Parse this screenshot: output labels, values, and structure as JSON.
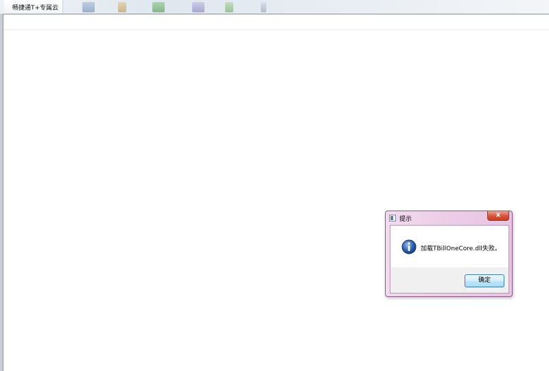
{
  "app": {
    "tab_title": "畅捷通T+专属云"
  },
  "dialog": {
    "title": "提示",
    "close_glyph": "x",
    "message": "加载TBillOneCore.dll失败。",
    "icon": "info-icon",
    "ok_label": "确定"
  },
  "colors": {
    "dialog_frame": "#eccde7",
    "close_button": "#d6523a",
    "info_icon": "#2a5fb0",
    "ok_button": "#bee6fd"
  }
}
